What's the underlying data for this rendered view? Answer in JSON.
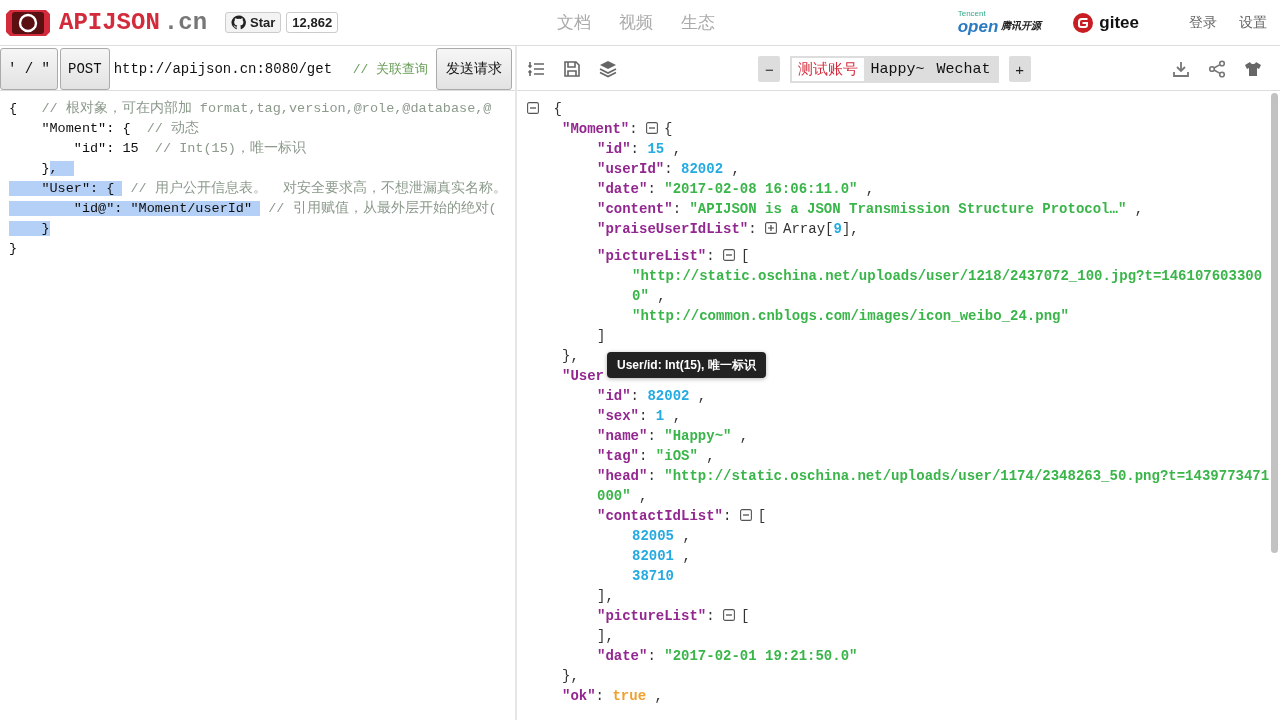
{
  "header": {
    "logo": {
      "name": "APIJSON",
      "suffix": ".cn"
    },
    "star": {
      "label": "Star",
      "count": "12,862"
    },
    "nav": [
      {
        "label": "文档"
      },
      {
        "label": "视频"
      },
      {
        "label": "生态"
      }
    ],
    "partner": {
      "company": "Tencent",
      "brand": "open",
      "label": "腾讯开源"
    },
    "gitee": {
      "label": "gitee"
    },
    "links": [
      {
        "label": "登录"
      },
      {
        "label": "设置"
      }
    ]
  },
  "request": {
    "quote_button": {
      "label": "' / \""
    },
    "method_button": {
      "label": "POST"
    },
    "url": {
      "value": "http://apijson.cn:8080/get"
    },
    "url_comment": "// 关联查询",
    "send_button": {
      "label": "发送请求"
    }
  },
  "editor": {
    "lines": [
      {
        "segments": [
          {
            "text": "{   ",
            "kind": "code",
            "selected": false
          },
          {
            "text": "// 根对象，可在内部加 format,tag,version,@role,@database,@",
            "kind": "comment",
            "selected": false
          }
        ]
      },
      {
        "segments": [
          {
            "text": "    \"Moment\": {  ",
            "kind": "code",
            "selected": false
          },
          {
            "text": "// 动态",
            "kind": "comment",
            "selected": false
          }
        ]
      },
      {
        "segments": [
          {
            "text": "        \"id\": 15  ",
            "kind": "code",
            "selected": false
          },
          {
            "text": "// Int(15)，唯一标识",
            "kind": "comment",
            "selected": false
          }
        ]
      },
      {
        "segments": [
          {
            "text": "    }",
            "kind": "code",
            "selected": false
          },
          {
            "text": ",  ",
            "kind": "code",
            "selected": true
          }
        ]
      },
      {
        "segments": [
          {
            "text": "    \"User\": { ",
            "kind": "code",
            "selected": true
          },
          {
            "text": " // 用户公开信息表。  对安全要求高，不想泄漏真实名称。",
            "kind": "comment",
            "selected": false
          }
        ]
      },
      {
        "segments": [
          {
            "text": "        \"id@\": \"Moment/userId\" ",
            "kind": "code",
            "selected": true
          },
          {
            "text": " // 引用赋值，从最外层开始的绝对(",
            "kind": "comment",
            "selected": false
          }
        ]
      },
      {
        "segments": [
          {
            "text": "    }",
            "kind": "code",
            "selected": true
          }
        ]
      },
      {
        "segments": [
          {
            "text": "}",
            "kind": "code",
            "selected": false
          }
        ]
      }
    ]
  },
  "viewer_toolbar": {
    "minus": "−",
    "tabs": [
      {
        "label": "测试账号",
        "selected": true
      },
      {
        "label": "Happy~",
        "selected": false
      },
      {
        "label": "Wechat",
        "selected": false
      }
    ],
    "plus": "+"
  },
  "viewer": {
    "tree": {
      "tokens": [
        {
          "kind": "toggle",
          "expanded": true
        },
        {
          "kind": "punct",
          "t": " {"
        }
      ],
      "children": [
        {
          "tokens": [
            {
              "kind": "key",
              "t": "\"Moment\""
            },
            {
              "kind": "punct",
              "t": ": "
            },
            {
              "kind": "toggle",
              "expanded": true
            },
            {
              "kind": "punct",
              "t": "{"
            }
          ],
          "children": [
            {
              "tokens": [
                {
                  "kind": "key",
                  "t": "\"id\""
                },
                {
                  "kind": "punct",
                  "t": ": "
                },
                {
                  "kind": "number",
                  "t": "15"
                },
                {
                  "kind": "punct",
                  "t": " ,"
                }
              ]
            },
            {
              "tokens": [
                {
                  "kind": "key",
                  "t": "\"userId\""
                },
                {
                  "kind": "punct",
                  "t": ": "
                },
                {
                  "kind": "number",
                  "t": "82002"
                },
                {
                  "kind": "punct",
                  "t": " ,"
                }
              ]
            },
            {
              "tokens": [
                {
                  "kind": "key",
                  "t": "\"date\""
                },
                {
                  "kind": "punct",
                  "t": ": "
                },
                {
                  "kind": "string",
                  "t": "\"2017-02-08 16:06:11.0\""
                },
                {
                  "kind": "punct",
                  "t": " ,"
                }
              ]
            },
            {
              "tokens": [
                {
                  "kind": "key",
                  "t": "\"content\""
                },
                {
                  "kind": "punct",
                  "t": ": "
                },
                {
                  "kind": "string",
                  "t": "\"APIJSON is a JSON Transmission Structure Protocol…\""
                },
                {
                  "kind": "punct",
                  "t": " ,"
                }
              ]
            },
            {
              "tokens": [
                {
                  "kind": "key",
                  "t": "\"praiseUserIdList\""
                },
                {
                  "kind": "punct",
                  "t": ": "
                },
                {
                  "kind": "toggle",
                  "expanded": false
                },
                {
                  "kind": "punct",
                  "t": "Array["
                },
                {
                  "kind": "number",
                  "t": "9"
                },
                {
                  "kind": "punct",
                  "t": "],"
                }
              ]
            },
            {
              "tokens": [
                {
                  "kind": "key",
                  "t": "\"pictureList\""
                },
                {
                  "kind": "punct",
                  "t": ": "
                },
                {
                  "kind": "toggle",
                  "expanded": true
                },
                {
                  "kind": "punct",
                  "t": "["
                }
              ],
              "gap": true,
              "children": [
                {
                  "tokens": [
                    {
                      "kind": "string",
                      "t": "\"http://static.oschina.net/uploads/user/1218/2437072_100.jpg?t=1461076033000\""
                    },
                    {
                      "kind": "punct",
                      "t": " ,"
                    }
                  ]
                },
                {
                  "tokens": [
                    {
                      "kind": "string",
                      "t": "\"http://common.cnblogs.com/images/icon_weibo_24.png\""
                    }
                  ]
                }
              ],
              "close": [
                {
                  "kind": "punct",
                  "t": "]"
                }
              ]
            }
          ],
          "close": [
            {
              "kind": "punct",
              "t": "},"
            }
          ]
        },
        {
          "tokens": [
            {
              "kind": "key",
              "t": "\"User"
            }
          ],
          "tooltip": "User/id: Int(15), 唯一标识",
          "children": [
            {
              "tokens": [
                {
                  "kind": "key",
                  "t": "\"id\""
                },
                {
                  "kind": "punct",
                  "t": ": "
                },
                {
                  "kind": "number",
                  "t": "82002"
                },
                {
                  "kind": "punct",
                  "t": " ,"
                }
              ]
            },
            {
              "tokens": [
                {
                  "kind": "key",
                  "t": "\"sex\""
                },
                {
                  "kind": "punct",
                  "t": ": "
                },
                {
                  "kind": "number",
                  "t": "1"
                },
                {
                  "kind": "punct",
                  "t": " ,"
                }
              ]
            },
            {
              "tokens": [
                {
                  "kind": "key",
                  "t": "\"name\""
                },
                {
                  "kind": "punct",
                  "t": ": "
                },
                {
                  "kind": "string",
                  "t": "\"Happy~\""
                },
                {
                  "kind": "punct",
                  "t": " ,"
                }
              ]
            },
            {
              "tokens": [
                {
                  "kind": "key",
                  "t": "\"tag\""
                },
                {
                  "kind": "punct",
                  "t": ": "
                },
                {
                  "kind": "string",
                  "t": "\"iOS\""
                },
                {
                  "kind": "punct",
                  "t": " ,"
                }
              ]
            },
            {
              "tokens": [
                {
                  "kind": "key",
                  "t": "\"head\""
                },
                {
                  "kind": "punct",
                  "t": ": "
                },
                {
                  "kind": "string",
                  "t": "\"http://static.oschina.net/uploads/user/1174/2348263_50.png?t=1439773471000\""
                },
                {
                  "kind": "punct",
                  "t": " ,"
                }
              ]
            },
            {
              "tokens": [
                {
                  "kind": "key",
                  "t": "\"contactIdList\""
                },
                {
                  "kind": "punct",
                  "t": ": "
                },
                {
                  "kind": "toggle",
                  "expanded": true
                },
                {
                  "kind": "punct",
                  "t": "["
                }
              ],
              "children": [
                {
                  "tokens": [
                    {
                      "kind": "number",
                      "t": "82005"
                    },
                    {
                      "kind": "punct",
                      "t": " ,"
                    }
                  ]
                },
                {
                  "tokens": [
                    {
                      "kind": "number",
                      "t": "82001"
                    },
                    {
                      "kind": "punct",
                      "t": " ,"
                    }
                  ]
                },
                {
                  "tokens": [
                    {
                      "kind": "number",
                      "t": "38710"
                    }
                  ]
                }
              ],
              "close": [
                {
                  "kind": "punct",
                  "t": "],"
                }
              ]
            },
            {
              "tokens": [
                {
                  "kind": "key",
                  "t": "\"pictureList\""
                },
                {
                  "kind": "punct",
                  "t": ": "
                },
                {
                  "kind": "toggle",
                  "expanded": true
                },
                {
                  "kind": "punct",
                  "t": "["
                }
              ],
              "close": [
                {
                  "kind": "punct",
                  "t": "],"
                }
              ]
            },
            {
              "tokens": [
                {
                  "kind": "key",
                  "t": "\"date\""
                },
                {
                  "kind": "punct",
                  "t": ": "
                },
                {
                  "kind": "string",
                  "t": "\"2017-02-01 19:21:50.0\""
                }
              ]
            }
          ],
          "close": [
            {
              "kind": "punct",
              "t": "},"
            }
          ]
        },
        {
          "tokens": [
            {
              "kind": "key",
              "t": "\"ok\""
            },
            {
              "kind": "punct",
              "t": ": "
            },
            {
              "kind": "boolean",
              "t": "true"
            },
            {
              "kind": "punct",
              "t": " ,"
            }
          ]
        }
      ]
    }
  }
}
